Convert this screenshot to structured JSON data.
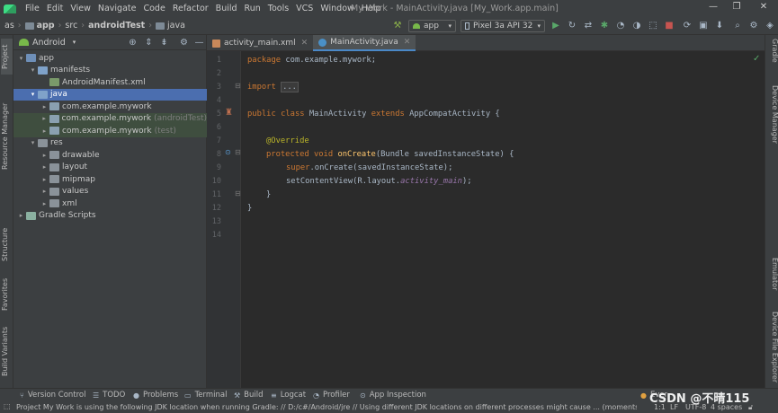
{
  "menu": {
    "items": [
      "File",
      "Edit",
      "View",
      "Navigate",
      "Code",
      "Refactor",
      "Build",
      "Run",
      "Tools",
      "VCS",
      "Window",
      "Help"
    ],
    "window_title": "My Work - MainActivity.java [My_Work.app.main]",
    "win_controls": [
      "—",
      "❐",
      "✕"
    ]
  },
  "nav": {
    "crumbs": [
      "as",
      "app",
      "src",
      "androidTest",
      "java"
    ],
    "run_config": "app",
    "device": "Pixel 3a API 32"
  },
  "project_panel": {
    "view_mode": "Android",
    "tree": [
      {
        "label": "app",
        "hint": "",
        "arrow": "▾",
        "indent": 0,
        "icon": "f-app",
        "state": ""
      },
      {
        "label": "manifests",
        "hint": "",
        "arrow": "▾",
        "indent": 1,
        "icon": "f-blue",
        "state": ""
      },
      {
        "label": "AndroidManifest.xml",
        "hint": "",
        "arrow": "",
        "indent": 2,
        "icon": "f-manifest",
        "state": ""
      },
      {
        "label": "java",
        "hint": "",
        "arrow": "▾",
        "indent": 1,
        "icon": "f-blue",
        "state": "selected"
      },
      {
        "label": "com.example.mywork",
        "hint": "",
        "arrow": "▸",
        "indent": 2,
        "icon": "f-pkg",
        "state": ""
      },
      {
        "label": "com.example.mywork",
        "hint": "(androidTest)",
        "arrow": "▸",
        "indent": 2,
        "icon": "f-pkg",
        "state": "tint"
      },
      {
        "label": "com.example.mywork",
        "hint": "(test)",
        "arrow": "▸",
        "indent": 2,
        "icon": "f-pkg",
        "state": "tint"
      },
      {
        "label": "res",
        "hint": "",
        "arrow": "▾",
        "indent": 1,
        "icon": "f-gray",
        "state": ""
      },
      {
        "label": "drawable",
        "hint": "",
        "arrow": "▸",
        "indent": 2,
        "icon": "f-gray",
        "state": ""
      },
      {
        "label": "layout",
        "hint": "",
        "arrow": "▸",
        "indent": 2,
        "icon": "f-gray",
        "state": ""
      },
      {
        "label": "mipmap",
        "hint": "",
        "arrow": "▸",
        "indent": 2,
        "icon": "f-gray",
        "state": ""
      },
      {
        "label": "values",
        "hint": "",
        "arrow": "▸",
        "indent": 2,
        "icon": "f-gray",
        "state": ""
      },
      {
        "label": "xml",
        "hint": "",
        "arrow": "▸",
        "indent": 2,
        "icon": "f-gray",
        "state": ""
      },
      {
        "label": "Gradle Scripts",
        "hint": "",
        "arrow": "▸",
        "indent": 0,
        "icon": "f-gradle",
        "state": ""
      }
    ]
  },
  "left_strip": [
    "Project",
    "Resource Manager",
    "Structure",
    "Favorites",
    "Build Variants"
  ],
  "right_strip": [
    "Gradle",
    "Device Manager",
    "Emulator",
    "Device File Explorer"
  ],
  "editor": {
    "tabs": [
      {
        "label": "activity_main.xml",
        "active": false
      },
      {
        "label": "MainActivity.java",
        "active": true
      }
    ],
    "line_numbers": [
      "1",
      "2",
      "3",
      "4",
      "5",
      "6",
      "7",
      "8",
      "9",
      "10",
      "11",
      "12",
      "13",
      "14"
    ],
    "code": {
      "l1_kw": "package",
      "l1_rest": " com.example.mywork;",
      "l3_kw": "import",
      "l3_fold": "...",
      "l7_kw": "public class",
      "l7_name": " MainActivity ",
      "l7_kw2": "extends",
      "l7_rest": " AppCompatActivity {",
      "l9_ann": "@Override",
      "l10_kw": "protected void",
      "l10_fn": " onCreate",
      "l10_rest": "(Bundle savedInstanceState) {",
      "l11_kw": "super",
      "l11_rest": ".onCreate(savedInstanceState);",
      "l12_pre": "setContentView(R.layout.",
      "l12_ital": "activity_main",
      "l12_post": ");",
      "l13": "}",
      "l14": "}"
    }
  },
  "bottom_tabs": [
    "Version Control",
    "TODO",
    "Problems",
    "Terminal",
    "Build",
    "Logcat",
    "Profiler",
    "App Inspection",
    "Event Log"
  ],
  "status": {
    "message": "Project My Work is using the following JDK location when running Gradle: // D:/c#/Android/jre // Using different JDK locations on different processes might cause ... (moments a",
    "position": "1:1",
    "line_sep": "LF",
    "encoding": "UTF-8",
    "indent": "4 spaces"
  },
  "watermark": "CSDN @不晴115",
  "colors": {
    "selection": "#4b6eaf",
    "keyword": "#cc7832",
    "annotation": "#bbb529",
    "method": "#ffc66d",
    "field_italic": "#9876aa",
    "text": "#a9b7c6"
  }
}
